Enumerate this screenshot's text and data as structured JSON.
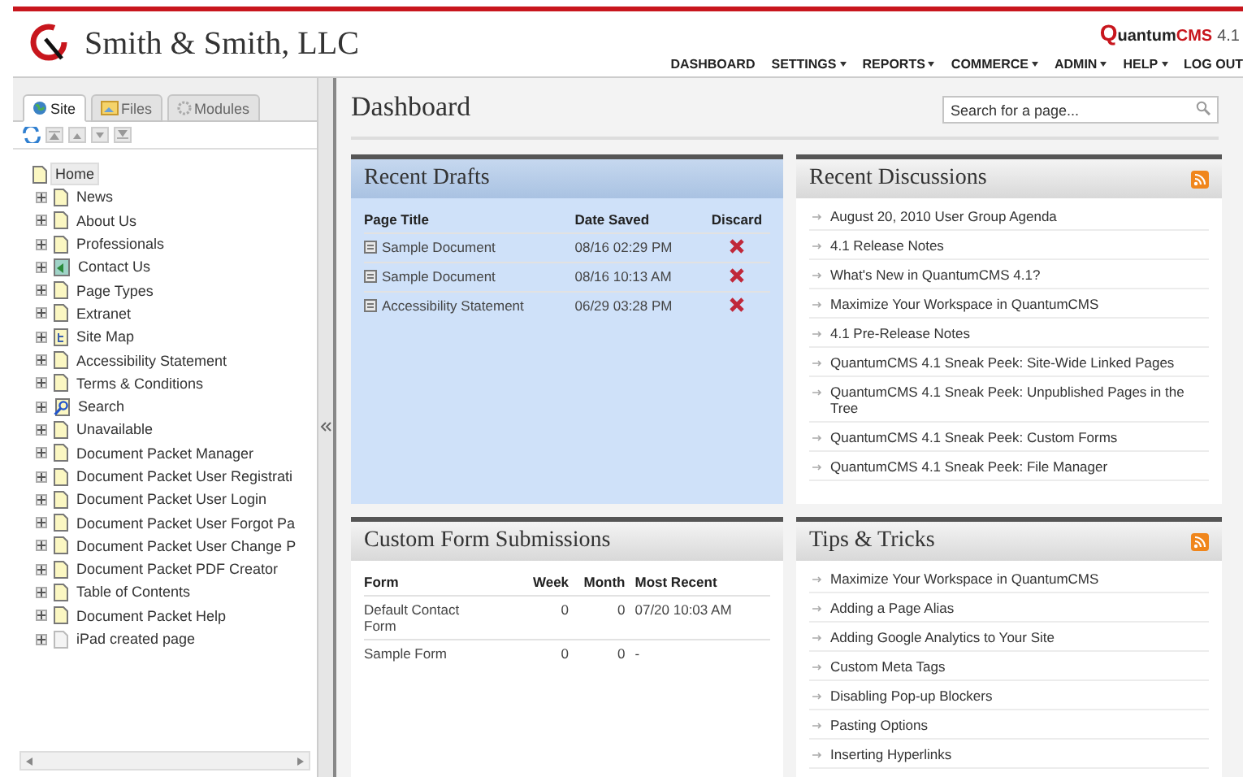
{
  "header": {
    "company": "Smith & Smith, LLC",
    "product": {
      "name": "Quantum",
      "edition": "CMS",
      "version": "4.1"
    },
    "nav": [
      {
        "label": "DASHBOARD",
        "has_menu": false
      },
      {
        "label": "SETTINGS",
        "has_menu": true
      },
      {
        "label": "REPORTS",
        "has_menu": true
      },
      {
        "label": "COMMERCE",
        "has_menu": true
      },
      {
        "label": "ADMIN",
        "has_menu": true
      },
      {
        "label": "HELP",
        "has_menu": true
      },
      {
        "label": "LOG OUT",
        "has_menu": false
      }
    ]
  },
  "sidebar": {
    "tabs": [
      {
        "label": "Site",
        "kind": "globe",
        "selected": true
      },
      {
        "label": "Files",
        "kind": "image",
        "selected": false
      },
      {
        "label": "Modules",
        "kind": "gear",
        "selected": false
      }
    ],
    "tree": [
      {
        "label": "Home",
        "kind": "page",
        "selected": true,
        "children": [
          {
            "label": "News",
            "kind": "page",
            "selected": false,
            "expanded": false
          },
          {
            "label": "About Us",
            "kind": "page",
            "selected": false,
            "expanded": false
          },
          {
            "label": "Professionals",
            "kind": "page",
            "selected": false,
            "expanded": false
          },
          {
            "label": "Contact Us",
            "kind": "contact",
            "selected": false,
            "expanded": false
          },
          {
            "label": "Page Types",
            "kind": "page",
            "selected": false,
            "expanded": false
          },
          {
            "label": "Extranet",
            "kind": "page",
            "selected": false,
            "expanded": false
          },
          {
            "label": "Site Map",
            "kind": "sitemap",
            "selected": false,
            "expanded": false
          },
          {
            "label": "Accessibility Statement",
            "kind": "page",
            "selected": false,
            "expanded": false
          },
          {
            "label": "Terms & Conditions",
            "kind": "page",
            "selected": false,
            "expanded": false
          },
          {
            "label": "Search",
            "kind": "search",
            "selected": false,
            "expanded": false
          },
          {
            "label": "Unavailable",
            "kind": "page",
            "selected": false,
            "expanded": false
          },
          {
            "label": "Document Packet Manager",
            "kind": "page",
            "selected": false,
            "expanded": false
          },
          {
            "label": "Document Packet User Registrati",
            "kind": "page",
            "selected": false,
            "expanded": false
          },
          {
            "label": "Document Packet User Login",
            "kind": "page",
            "selected": false,
            "expanded": false
          },
          {
            "label": "Document Packet User Forgot Pa",
            "kind": "page",
            "selected": false,
            "expanded": false
          },
          {
            "label": "Document Packet User Change P",
            "kind": "page",
            "selected": false,
            "expanded": false
          },
          {
            "label": "Document Packet PDF Creator",
            "kind": "page",
            "selected": false,
            "expanded": false
          },
          {
            "label": "Table of Contents",
            "kind": "page",
            "selected": false,
            "expanded": false
          },
          {
            "label": "Document Packet Help",
            "kind": "page",
            "selected": false,
            "expanded": false
          },
          {
            "label": "iPad created page",
            "kind": "blank",
            "selected": false,
            "expanded": false
          }
        ]
      }
    ]
  },
  "main": {
    "title": "Dashboard",
    "search": {
      "placeholder": "Search for a page..."
    },
    "panels": [
      {
        "kind": "drafts",
        "title": "Recent Drafts",
        "highlighted": true,
        "rss": false,
        "columns": [
          "Page Title",
          "Date Saved",
          "Discard"
        ],
        "rows": [
          {
            "title": "Sample Document",
            "saved": "08/16 02:29 PM"
          },
          {
            "title": "Sample Document",
            "saved": "08/16 10:13 AM"
          },
          {
            "title": "Accessibility Statement",
            "saved": "06/29 03:28 PM"
          }
        ]
      },
      {
        "kind": "links",
        "title": "Recent Discussions",
        "highlighted": false,
        "rss": true,
        "items": [
          "August 20, 2010 User Group Agenda",
          "4.1 Release Notes",
          "What's New in QuantumCMS 4.1?",
          "Maximize Your Workspace in QuantumCMS",
          "4.1 Pre-Release Notes",
          "QuantumCMS 4.1 Sneak Peek: Site-Wide Linked Pages",
          "QuantumCMS 4.1 Sneak Peek: Unpublished Pages in the Tree",
          "QuantumCMS 4.1 Sneak Peek: Custom Forms",
          "QuantumCMS 4.1 Sneak Peek: File Manager"
        ]
      },
      {
        "kind": "forms",
        "title": "Custom Form Submissions",
        "highlighted": false,
        "rss": false,
        "columns": [
          "Form",
          "Week",
          "Month",
          "Most Recent"
        ],
        "rows": [
          {
            "form": "Default Contact Form",
            "week": "0",
            "month": "0",
            "recent": "07/20 10:03 AM"
          },
          {
            "form": "Sample Form",
            "week": "0",
            "month": "0",
            "recent": "-"
          }
        ]
      },
      {
        "kind": "links",
        "title": "Tips & Tricks",
        "highlighted": false,
        "rss": true,
        "items": [
          "Maximize Your Workspace in QuantumCMS",
          "Adding a Page Alias",
          "Adding Google Analytics to Your Site",
          "Custom Meta Tags",
          "Disabling Pop-up Blockers",
          "Pasting Options",
          "Inserting Hyperlinks"
        ]
      }
    ]
  }
}
